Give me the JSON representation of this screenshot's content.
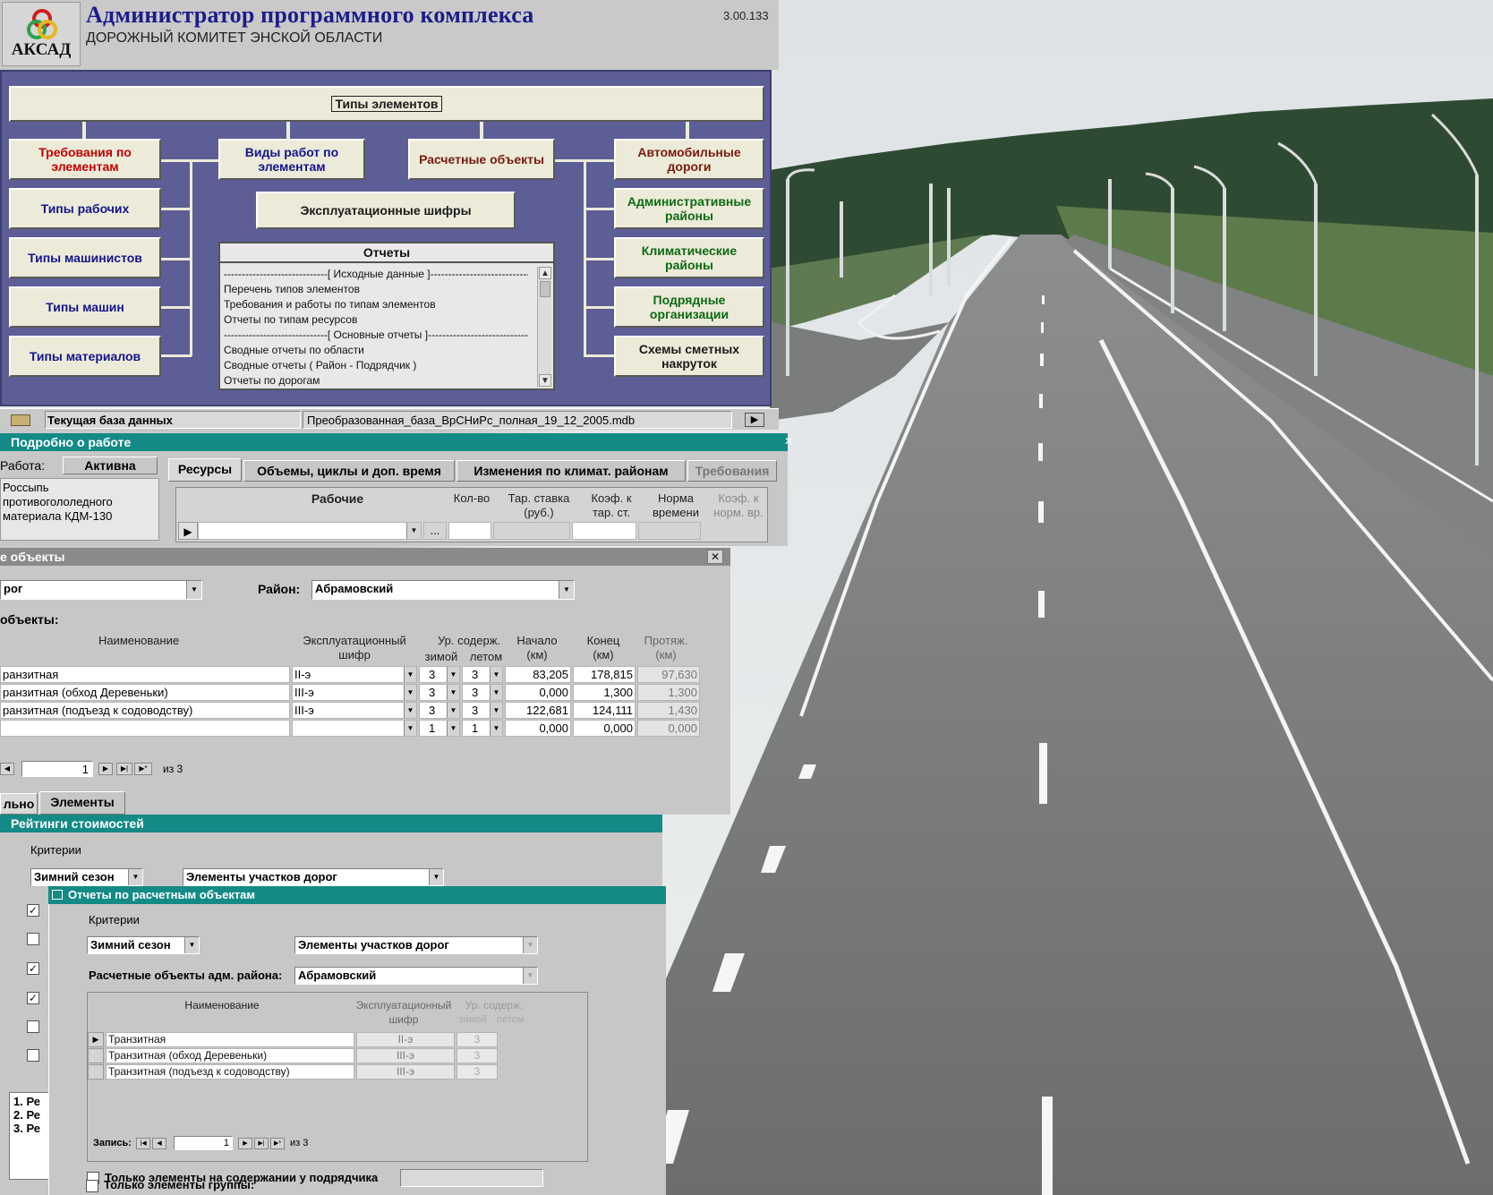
{
  "header": {
    "logo_text": "АКСАД",
    "title": "Администратор программного комплекса",
    "subtitle": "ДОРОЖНЫЙ КОМИТЕТ ЭНСКОЙ ОБЛАСТИ",
    "version": "3.00.133"
  },
  "main_panel": {
    "top_button": "Типы элементов",
    "left_buttons": [
      "Требования по элементам",
      "Типы рабочих",
      "Типы машинистов",
      "Типы машин",
      "Типы материалов"
    ],
    "center_buttons": [
      "Виды работ по элементам",
      "Расчетные объекты",
      "Эксплуатационные шифры"
    ],
    "right_buttons": [
      "Автомобильные дороги",
      "Административные районы",
      "Климатические районы",
      "Подрядные организации",
      "Схемы сметных накруток"
    ],
    "reports": {
      "title": "Отчеты",
      "items": [
        "-----------------------------[ Исходные данные ]-----------------------------",
        "Перечень типов элементов",
        "Требования и работы по типам элементов",
        "Отчеты по типам ресурсов",
        "-----------------------------[ Основные отчеты ]-----------------------------",
        "Сводные отчеты по области",
        "Сводные отчеты ( Район - Подрядчик )",
        "Отчеты по дорогам"
      ]
    },
    "db_label": "Текущая база данных",
    "db_value": "Преобразованная_база_ВрСНиРс_полная_19_12_2005.mdb"
  },
  "work_window": {
    "title": "Подробно о работе",
    "work_label": "Работа:",
    "status": "Активна",
    "description": "Россыпь противогололедного материала КДМ-130",
    "tabs": [
      "Ресурсы",
      "Объемы, циклы и доп. время",
      "Изменения по климат. районам",
      "Требования"
    ],
    "columns": [
      "Рабочие",
      "Кол-во",
      "Тар. ставка (руб.)",
      "Коэф. к тар. ст.",
      "Норма времени",
      "Коэф. к норм. вр."
    ],
    "ellipsis": "..."
  },
  "objects_window": {
    "title": "е объекты",
    "road_value": "рог",
    "district_label": "Район:",
    "district_value": "Абрамовский",
    "objects_label": "объекты:",
    "columns": {
      "name": "Наименование",
      "code": "Эксплуатационный шифр",
      "level": "Ур. содерж.",
      "winter": "зимой",
      "summer": "летом",
      "start": "Начало (км)",
      "end": "Конец (км)",
      "length": "Протяж. (км)"
    },
    "rows": [
      {
        "name": "ранзитная",
        "code": "II-э",
        "winter": "3",
        "summer": "3",
        "start": "83,205",
        "end": "178,815",
        "length": "97,630"
      },
      {
        "name": "ранзитная (обход Деревеньки)",
        "code": "III-э",
        "winter": "3",
        "summer": "3",
        "start": "0,000",
        "end": "1,300",
        "length": "1,300"
      },
      {
        "name": "ранзитная (подъезд к содоводству)",
        "code": "III-э",
        "winter": "3",
        "summer": "3",
        "start": "122,681",
        "end": "124,111",
        "length": "1,430"
      },
      {
        "name": "",
        "code": "",
        "winter": "1",
        "summer": "1",
        "start": "0,000",
        "end": "0,000",
        "length": "0,000"
      }
    ],
    "record_current": "1",
    "record_total": "из 3",
    "bottom_tabs": [
      "льно",
      "Элементы"
    ]
  },
  "ratings_window": {
    "title": "Рейтинги стоимостей",
    "criteria_label": "Критерии",
    "season": "Зимний сезон",
    "elements": "Элементы участков дорог",
    "checkboxes": [
      true,
      false,
      true,
      true,
      false,
      false
    ],
    "list": [
      "1. Ре",
      "2. Ре",
      "3. Ре"
    ]
  },
  "reports_window": {
    "title": "Отчеты по расчетным объектам",
    "criteria_label": "Критерии",
    "season": "Зимний сезон",
    "elements": "Элементы участков дорог",
    "district_label": "Расчетные объекты адм. района:",
    "district_value": "Абрамовский",
    "columns": {
      "name": "Наименование",
      "code": "Эксплуатационный шифр",
      "level": "Ур. содерж.",
      "winter": "зимой",
      "summer": "летом"
    },
    "rows": [
      {
        "name": "Транзитная",
        "code": "II-э",
        "level": "3"
      },
      {
        "name": "Транзитная (обход Деревеньки)",
        "code": "III-э",
        "level": "3"
      },
      {
        "name": "Транзитная (подъезд к содоводству)",
        "code": "III-э",
        "level": "3"
      }
    ],
    "record_label": "Запись:",
    "record_current": "1",
    "record_total": "из 3",
    "check1": "Только элементы на содержании у подрядчика",
    "check2": "Только элементы группы:"
  }
}
